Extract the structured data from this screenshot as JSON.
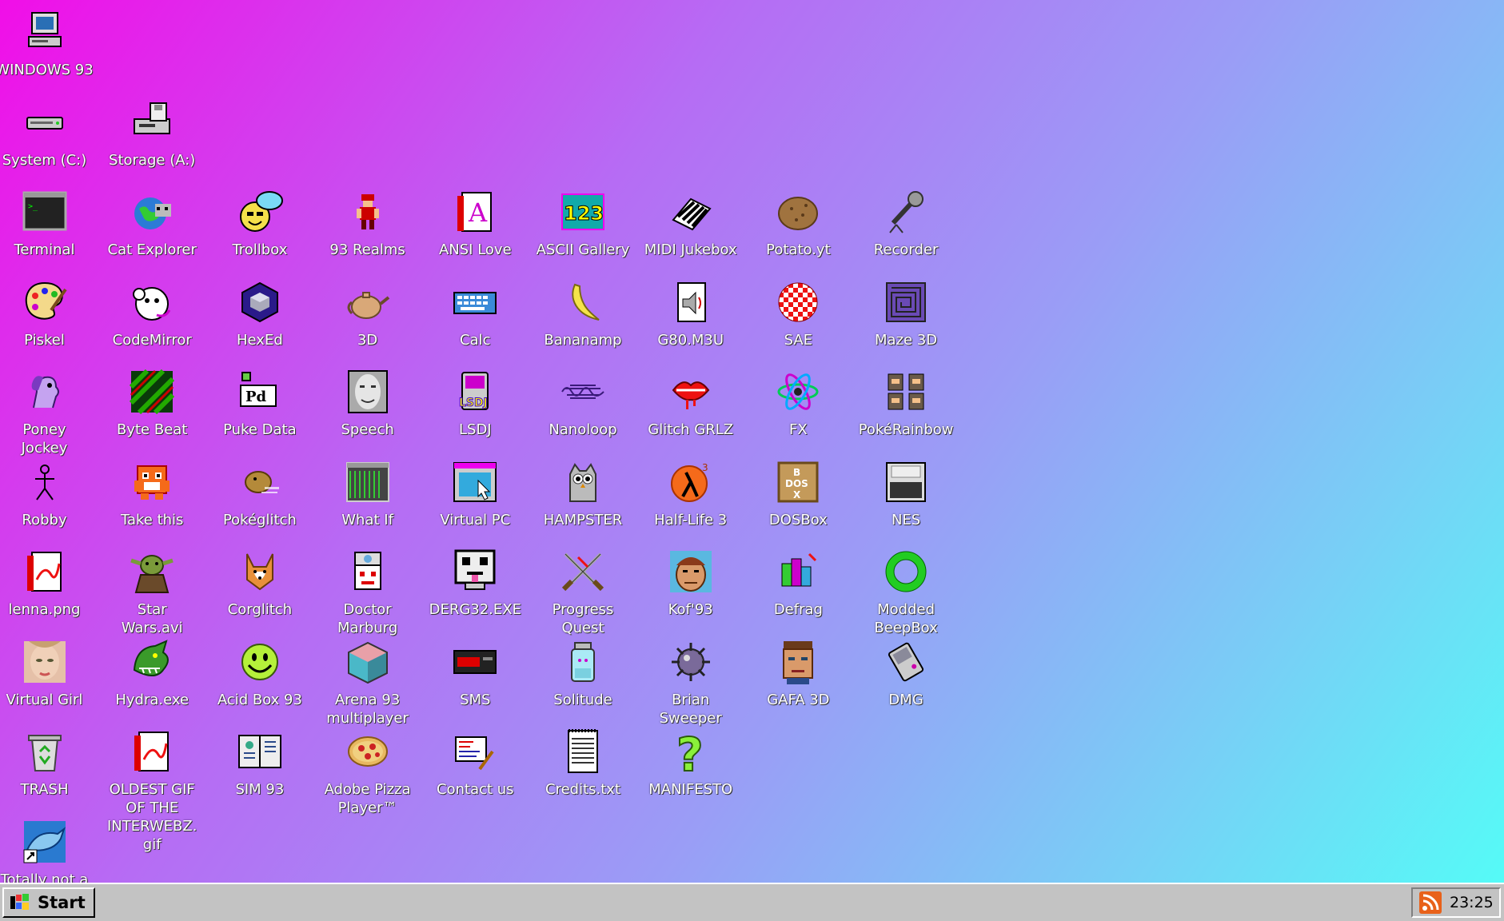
{
  "desktop": {
    "icons": [
      {
        "name": "windows-93",
        "label": "WINDOWS 93",
        "icon": "computer-icon",
        "col": 0,
        "row": 0
      },
      {
        "name": "system-c",
        "label": "System (C:)",
        "icon": "hard-drive-icon",
        "col": 0,
        "row": 1
      },
      {
        "name": "storage-a",
        "label": "Storage (A:)",
        "icon": "floppy-drive-icon",
        "col": 1,
        "row": 1
      },
      {
        "name": "terminal",
        "label": "Terminal",
        "icon": "terminal-icon",
        "col": 0,
        "row": 2
      },
      {
        "name": "cat-explorer",
        "label": "Cat Explorer",
        "icon": "globe-cat-icon",
        "col": 1,
        "row": 2
      },
      {
        "name": "trollbox",
        "label": "Trollbox",
        "icon": "chat-face-icon",
        "col": 2,
        "row": 2
      },
      {
        "name": "93-realms",
        "label": "93 Realms",
        "icon": "pixel-warrior-icon",
        "col": 3,
        "row": 2
      },
      {
        "name": "ansi-love",
        "label": "ANSI Love",
        "icon": "letter-a-icon",
        "col": 4,
        "row": 2
      },
      {
        "name": "ascii-gallery",
        "label": "ASCII Gallery",
        "icon": "numbers-icon",
        "col": 5,
        "row": 2
      },
      {
        "name": "midi-jukebox",
        "label": "MIDI Jukebox",
        "icon": "piano-icon",
        "col": 6,
        "row": 2
      },
      {
        "name": "potato-yt",
        "label": "Potato.yt",
        "icon": "potato-icon",
        "col": 7,
        "row": 2
      },
      {
        "name": "recorder",
        "label": "Recorder",
        "icon": "microphone-icon",
        "col": 8,
        "row": 2
      },
      {
        "name": "piskel",
        "label": "Piskel",
        "icon": "palette-icon",
        "col": 0,
        "row": 3
      },
      {
        "name": "codemirror",
        "label": "CodeMirror",
        "icon": "monkey-icon",
        "col": 1,
        "row": 3
      },
      {
        "name": "hexed",
        "label": "HexEd",
        "icon": "hexagon-cube-icon",
        "col": 2,
        "row": 3
      },
      {
        "name": "3d",
        "label": "3D",
        "icon": "teapot-icon",
        "col": 3,
        "row": 3
      },
      {
        "name": "calc",
        "label": "Calc",
        "icon": "keyboard-icon",
        "col": 4,
        "row": 3
      },
      {
        "name": "bananamp",
        "label": "Bananamp",
        "icon": "banana-icon",
        "col": 5,
        "row": 3
      },
      {
        "name": "g80-m3u",
        "label": "G80.M3U",
        "icon": "audio-file-icon",
        "col": 6,
        "row": 3
      },
      {
        "name": "sae",
        "label": "SAE",
        "icon": "checker-ball-icon",
        "col": 7,
        "row": 3
      },
      {
        "name": "maze-3d",
        "label": "Maze 3D",
        "icon": "maze-icon",
        "col": 8,
        "row": 3
      },
      {
        "name": "poney-jockey",
        "label": "Poney\nJockey",
        "icon": "pony-icon",
        "col": 0,
        "row": 4
      },
      {
        "name": "byte-beat",
        "label": "Byte Beat",
        "icon": "byte-beat-icon",
        "col": 1,
        "row": 4
      },
      {
        "name": "puke-data",
        "label": "Puke Data",
        "icon": "pd-icon",
        "col": 2,
        "row": 4
      },
      {
        "name": "speech",
        "label": "Speech",
        "icon": "face-icon",
        "col": 3,
        "row": 4
      },
      {
        "name": "lsdj",
        "label": "LSDJ",
        "icon": "gameboy-icon",
        "col": 4,
        "row": 4
      },
      {
        "name": "nanoloop",
        "label": "Nanoloop",
        "icon": "waveform-icon",
        "col": 5,
        "row": 4
      },
      {
        "name": "glitch-grlz",
        "label": "Glitch GRLZ",
        "icon": "lips-icon",
        "col": 6,
        "row": 4
      },
      {
        "name": "fx",
        "label": "FX",
        "icon": "atom-icon",
        "col": 7,
        "row": 4
      },
      {
        "name": "pokerainbow",
        "label": "PokéRainbow",
        "icon": "characters-icon",
        "col": 8,
        "row": 4
      },
      {
        "name": "robby",
        "label": "Robby",
        "icon": "stick-figure-icon",
        "col": 0,
        "row": 5
      },
      {
        "name": "take-this",
        "label": "Take this",
        "icon": "orange-creature-icon",
        "col": 1,
        "row": 5
      },
      {
        "name": "pokeglitch",
        "label": "Pokéglitch",
        "icon": "glitch-creature-icon",
        "col": 2,
        "row": 5
      },
      {
        "name": "what-if",
        "label": "What If",
        "icon": "green-window-icon",
        "col": 3,
        "row": 5
      },
      {
        "name": "virtual-pc",
        "label": "Virtual PC",
        "icon": "window-cursor-icon",
        "col": 4,
        "row": 5
      },
      {
        "name": "hampster",
        "label": "HAMPSTER",
        "icon": "owl-icon",
        "col": 5,
        "row": 5
      },
      {
        "name": "half-life-3",
        "label": "Half-Life 3",
        "icon": "lambda-icon",
        "col": 6,
        "row": 5
      },
      {
        "name": "dosbox",
        "label": "DOSBox",
        "icon": "crate-icon",
        "col": 7,
        "row": 5
      },
      {
        "name": "nes",
        "label": "NES",
        "icon": "nes-console-icon",
        "col": 8,
        "row": 5
      },
      {
        "name": "lenna-png",
        "label": "lenna.png",
        "icon": "image-file-icon",
        "col": 0,
        "row": 6
      },
      {
        "name": "star-wars-avi",
        "label": "Star\nWars.avi",
        "icon": "yoda-icon",
        "col": 1,
        "row": 6
      },
      {
        "name": "corglitch",
        "label": "Corglitch",
        "icon": "corgi-icon",
        "col": 2,
        "row": 6
      },
      {
        "name": "doctor-marburg",
        "label": "Doctor\nMarburg",
        "icon": "doctor-icon",
        "col": 3,
        "row": 6
      },
      {
        "name": "derg32-exe",
        "label": "DERG32.EXE",
        "icon": "monitor-face-icon",
        "col": 4,
        "row": 6
      },
      {
        "name": "progress-quest",
        "label": "Progress\nQuest",
        "icon": "crossed-swords-icon",
        "col": 5,
        "row": 6
      },
      {
        "name": "kof93",
        "label": "Kof'93",
        "icon": "fighter-portrait-icon",
        "col": 6,
        "row": 6
      },
      {
        "name": "defrag",
        "label": "Defrag",
        "icon": "defrag-blocks-icon",
        "col": 7,
        "row": 6
      },
      {
        "name": "modded-beepbox",
        "label": "Modded\nBeepBox",
        "icon": "green-ring-icon",
        "col": 8,
        "row": 6
      },
      {
        "name": "virtual-girl",
        "label": "Virtual Girl",
        "icon": "girl-face-icon",
        "col": 0,
        "row": 7
      },
      {
        "name": "hydra-exe",
        "label": "Hydra.exe",
        "icon": "dragon-icon",
        "col": 1,
        "row": 7
      },
      {
        "name": "acid-box-93",
        "label": "Acid Box 93",
        "icon": "smiley-icon",
        "col": 2,
        "row": 7
      },
      {
        "name": "arena-93",
        "label": "Arena 93\nmultiplayer",
        "icon": "cube-icon",
        "col": 3,
        "row": 7
      },
      {
        "name": "sms",
        "label": "SMS",
        "icon": "sms-console-icon",
        "col": 4,
        "row": 7
      },
      {
        "name": "solitude",
        "label": "Solitude",
        "icon": "jar-icon",
        "col": 5,
        "row": 7
      },
      {
        "name": "brian-sweeper",
        "label": "Brian\nSweeper",
        "icon": "mine-icon",
        "col": 6,
        "row": 7
      },
      {
        "name": "gafa-3d",
        "label": "GAFA 3D",
        "icon": "soldier-face-icon",
        "col": 7,
        "row": 7
      },
      {
        "name": "dmg",
        "label": "DMG",
        "icon": "gameboy-tilted-icon",
        "col": 8,
        "row": 7
      },
      {
        "name": "trash",
        "label": "TRASH",
        "icon": "recycle-bin-icon",
        "col": 0,
        "row": 8
      },
      {
        "name": "oldest-gif",
        "label": "OLDEST GIF\nOF THE\nINTERWEBZ.\ngif",
        "icon": "gif-file-icon",
        "col": 1,
        "row": 8
      },
      {
        "name": "sim-93",
        "label": "SIM 93",
        "icon": "book-icon",
        "col": 2,
        "row": 8
      },
      {
        "name": "adobe-pizza",
        "label": "Adobe Pizza\nPlayer™",
        "icon": "pizza-icon",
        "col": 3,
        "row": 8
      },
      {
        "name": "contact-us",
        "label": "Contact us",
        "icon": "letter-pen-icon",
        "col": 4,
        "row": 8
      },
      {
        "name": "credits-txt",
        "label": "Credits.txt",
        "icon": "text-file-icon",
        "col": 5,
        "row": 8
      },
      {
        "name": "manifesto",
        "label": "MANIFESTO",
        "icon": "question-mark-icon",
        "col": 6,
        "row": 8
      },
      {
        "name": "totally-not-a",
        "label": "Totally not a",
        "icon": "dolphin-shortcut-icon",
        "col": 0,
        "row": 9
      }
    ]
  },
  "taskbar": {
    "start_label": "Start",
    "start_icon": "windows-flag-icon",
    "tray_icon": "rss-icon",
    "clock": "23:25"
  },
  "colors": {
    "gradient_start": "#f10ee8",
    "gradient_end": "#55fbf7",
    "taskbar": "#c3c3c3",
    "rss": "#e8611a"
  }
}
